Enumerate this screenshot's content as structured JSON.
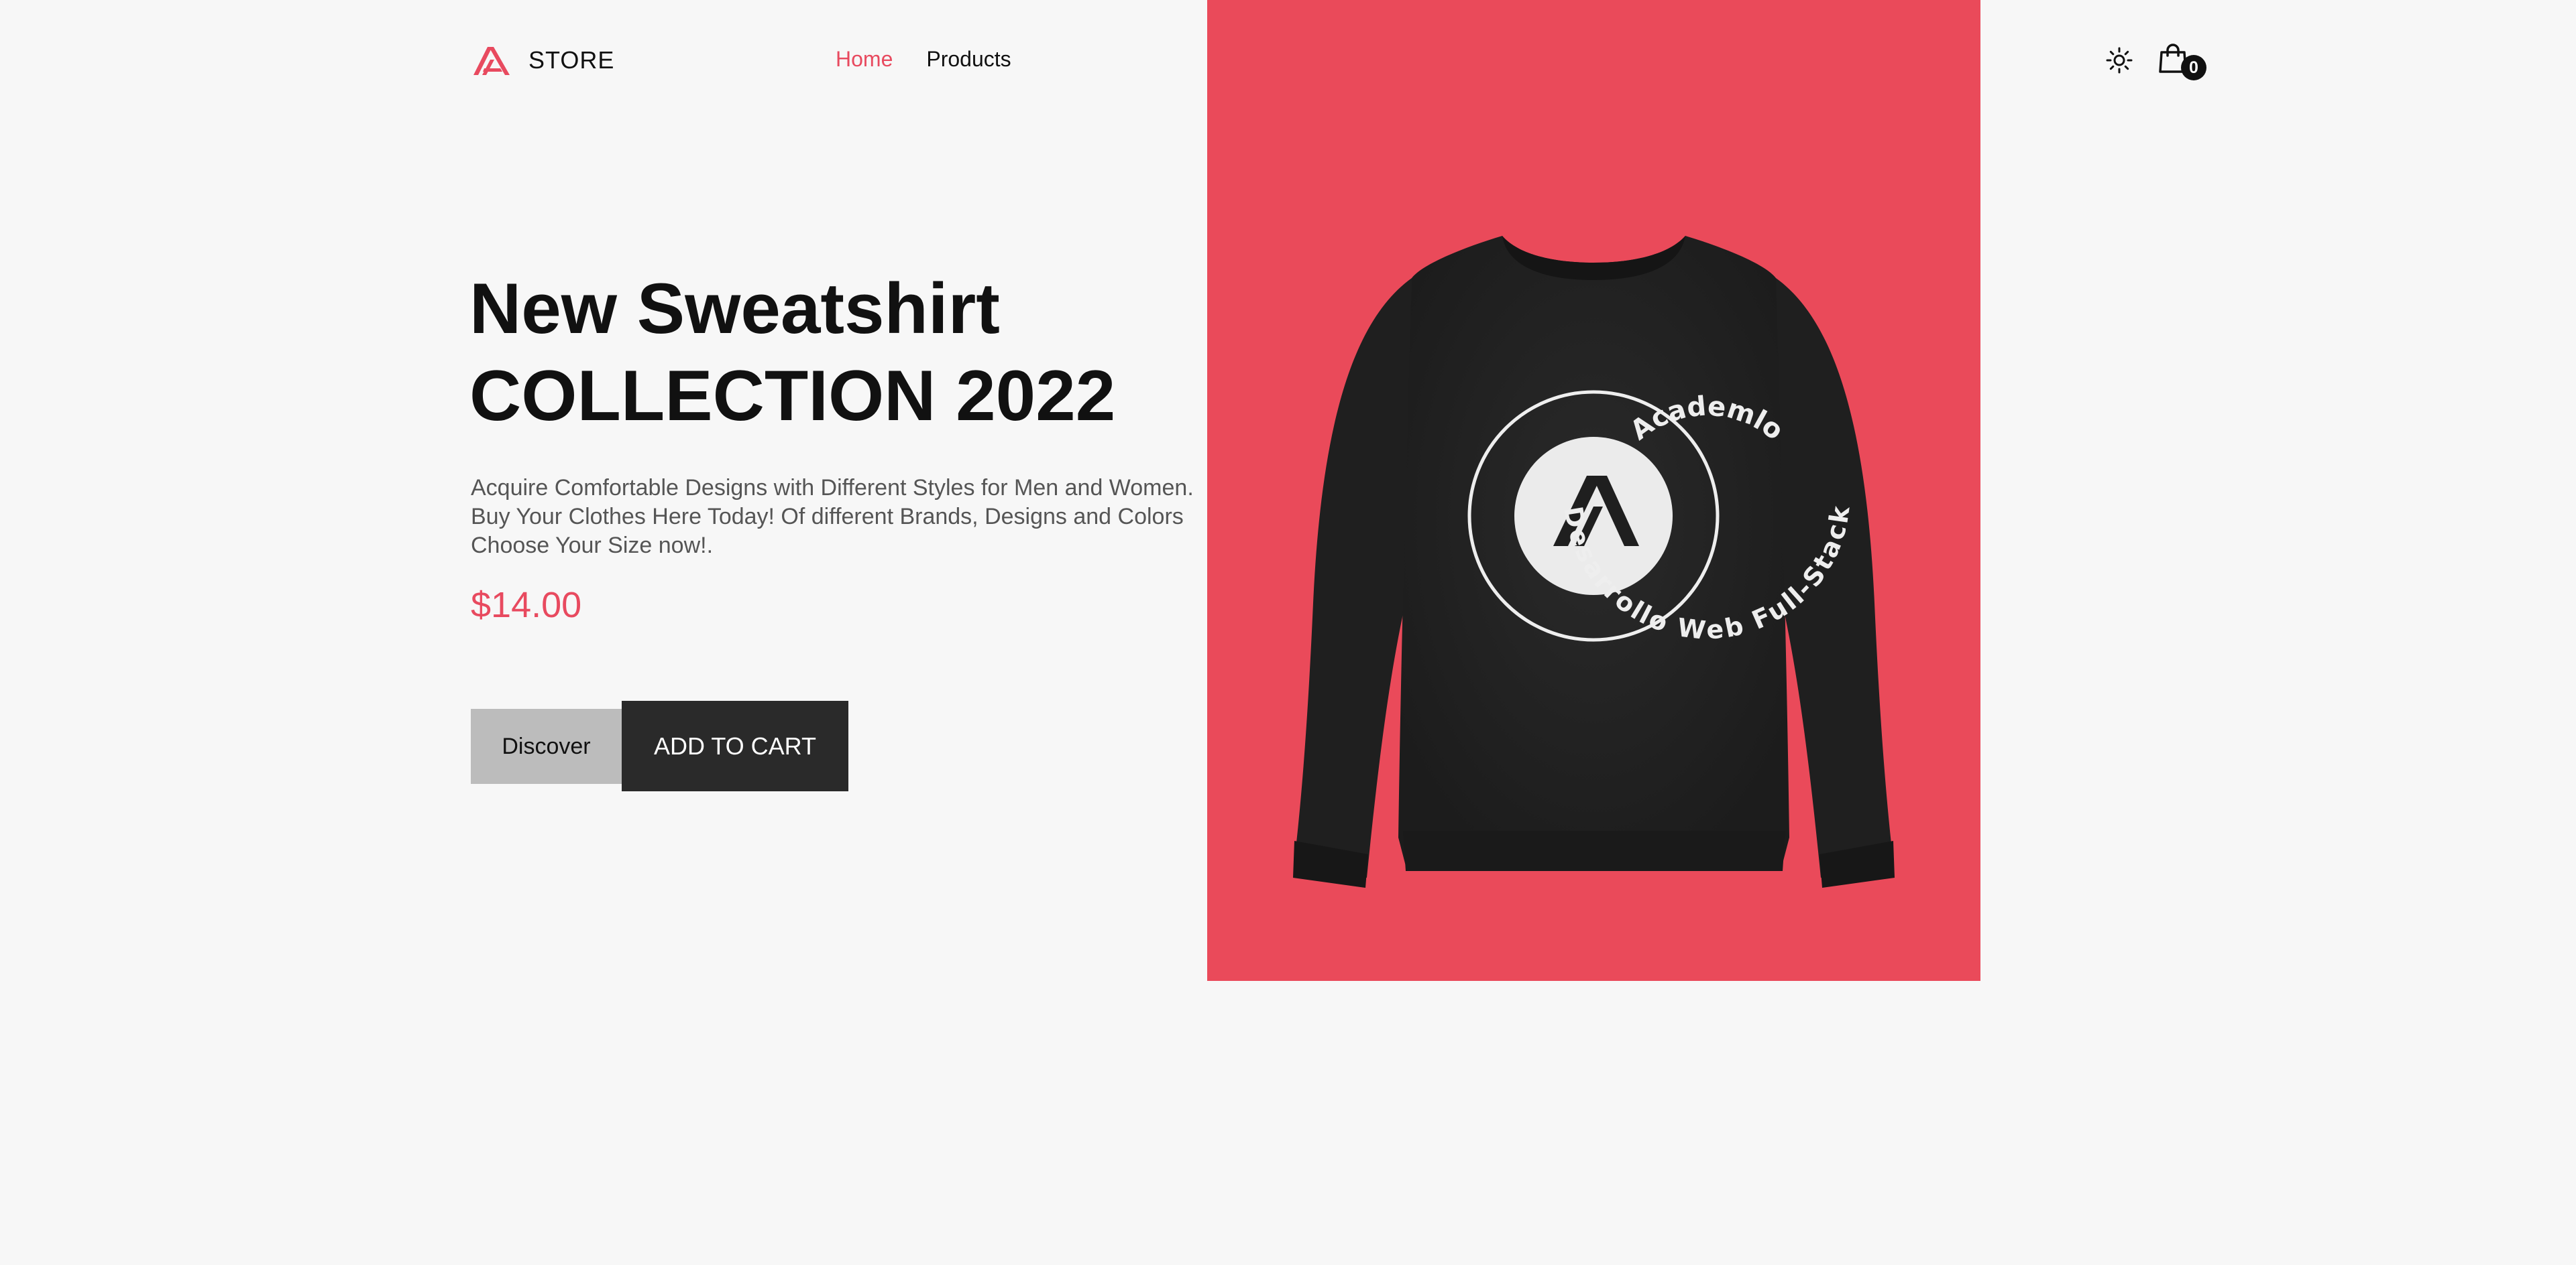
{
  "brand": {
    "name": "STORE",
    "logo_icon": "academlo-logo-icon",
    "accent_color": "#e84a5f"
  },
  "nav": {
    "items": [
      {
        "label": "Home",
        "active": true
      },
      {
        "label": "Products",
        "active": false
      }
    ]
  },
  "header_actions": {
    "theme_icon": "sun-icon",
    "cart_icon": "shopping-bag-icon",
    "cart_count": "0"
  },
  "hero": {
    "title_line1": "New Sweatshirt",
    "title_line2": "COLLECTION 2022",
    "description": "Acquire Comfortable Designs with Different Styles for Men and Women. Buy Your Clothes Here Today! Of different Brands, Designs and Colors Choose Your Size now!.",
    "price": "$14.00",
    "discover_label": "Discover",
    "add_to_cart_label": "ADD TO CART"
  },
  "product_image": {
    "background_color": "#ea4a5a",
    "garment_color": "#242424",
    "badge_top_text": "Academlo",
    "badge_bottom_text": "Desarrollo Web Full-Stack"
  }
}
